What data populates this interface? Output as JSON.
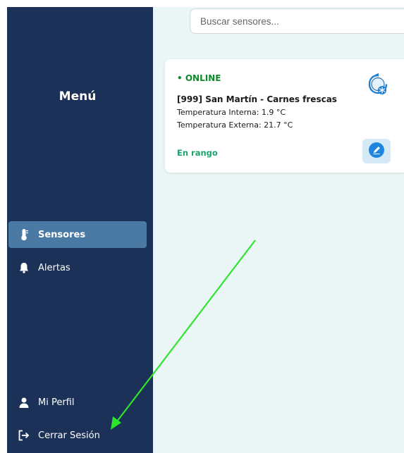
{
  "sidebar": {
    "title": "Menú",
    "items": [
      {
        "label": "Sensores",
        "icon": "thermometer-icon",
        "active": true
      },
      {
        "label": "Alertas",
        "icon": "bell-icon",
        "active": false
      },
      {
        "label": "Mi Perfil",
        "icon": "user-icon",
        "active": false
      },
      {
        "label": "Cerrar Sesión",
        "icon": "logout-icon",
        "active": false
      }
    ]
  },
  "search": {
    "placeholder": "Buscar sensores..."
  },
  "sensor_card": {
    "status": "• ONLINE",
    "name": "[999] San Martín - Carnes frescas",
    "internal_temp": "Temperatura Interna: 1.9 °C",
    "external_temp": "Temperatura Externa: 21.7 °C",
    "range_status": "En rango",
    "device_icon": "refrigeration-device-icon",
    "edit_icon": "edit-pencil-icon"
  },
  "colors": {
    "sidebar_bg": "#1c3157",
    "sidebar_active": "#4a7aa3",
    "main_bg": "#ebf6f6",
    "online": "#0d8a2a",
    "in_range": "#1ba46a",
    "annotation_arrow": "#2ee52e"
  }
}
